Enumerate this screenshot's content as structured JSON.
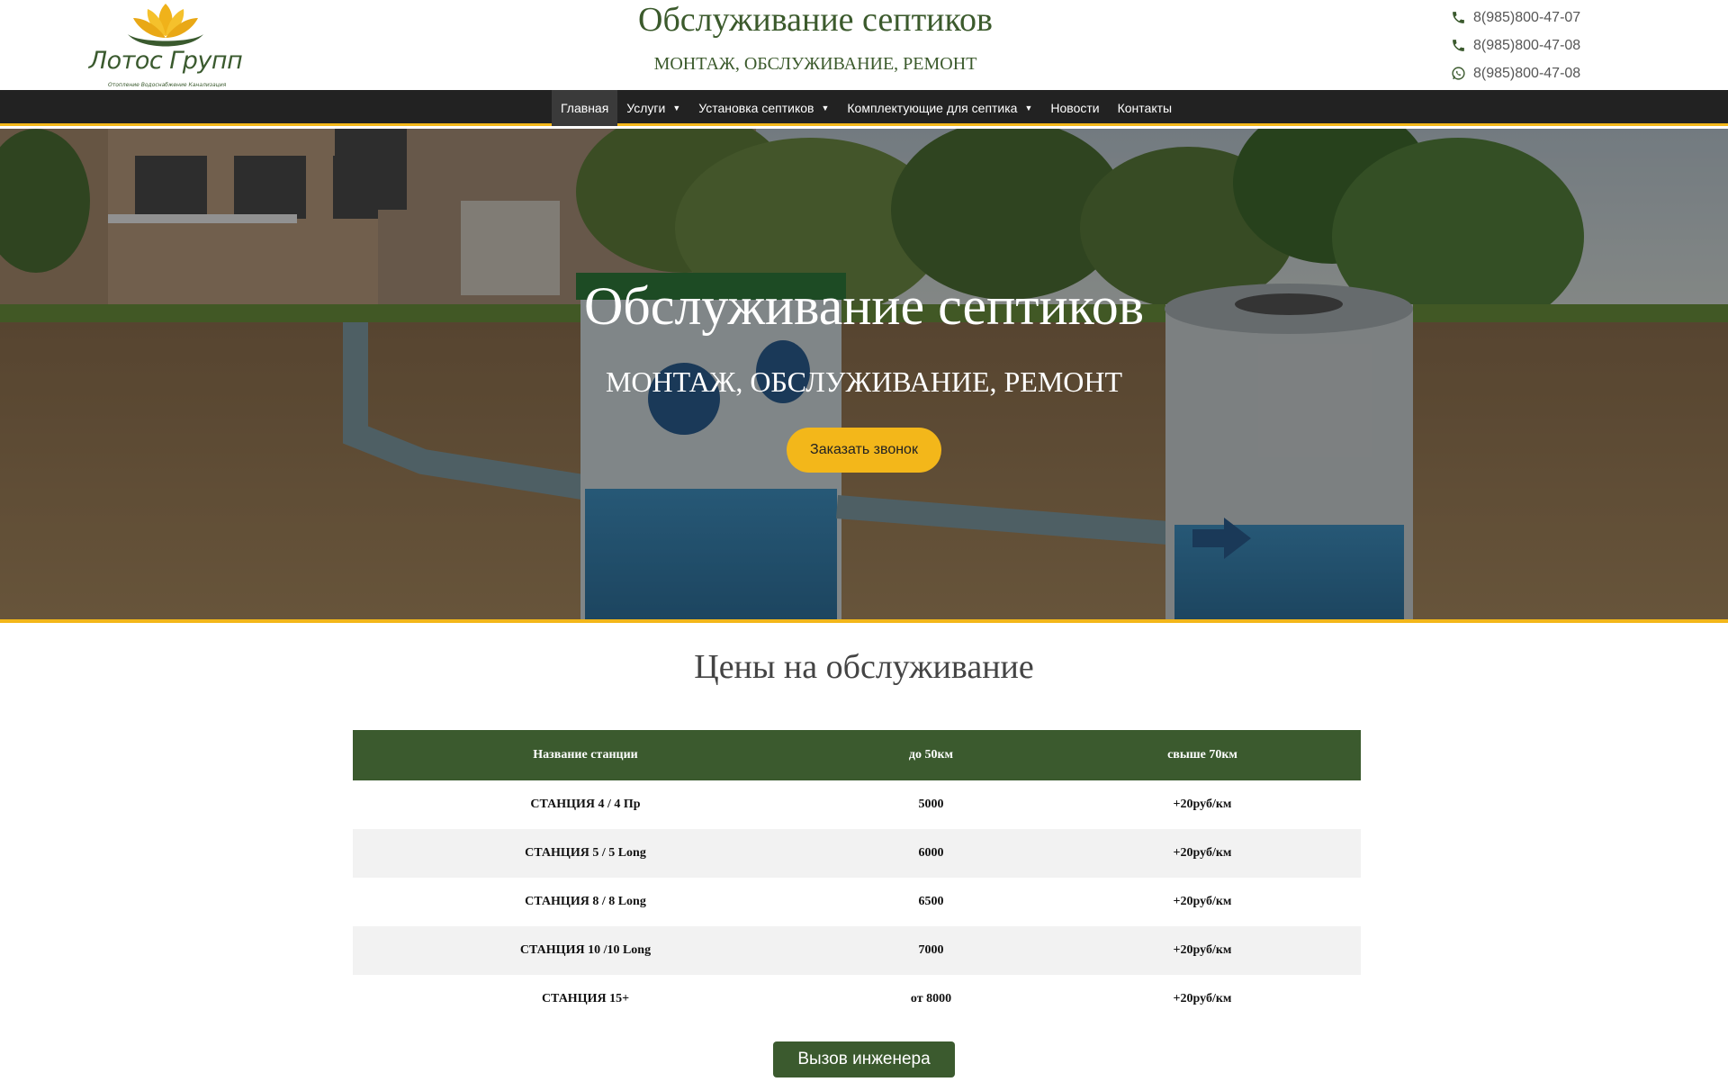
{
  "header": {
    "logo_text": "Лотос Групп",
    "logo_sub": "Отопление Водоснабжение Канализация",
    "title": "Обслуживание септиков",
    "subtitle": "МОНТАЖ, ОБСЛУЖИВАНИЕ, РЕМОНТ",
    "phones": [
      {
        "icon": "phone-icon",
        "number": "8(985)800-47-07"
      },
      {
        "icon": "phone-icon",
        "number": "8(985)800-47-08"
      },
      {
        "icon": "whatsapp-icon",
        "number": "8(985)800-47-08"
      }
    ]
  },
  "nav": {
    "items": [
      {
        "label": "Главная",
        "active": true,
        "dropdown": false
      },
      {
        "label": "Услуги",
        "dropdown": true
      },
      {
        "label": "Установка септиков",
        "dropdown": true
      },
      {
        "label": "Комплектующие для септика",
        "dropdown": true
      },
      {
        "label": "Новости",
        "dropdown": false
      },
      {
        "label": "Контакты",
        "dropdown": false
      }
    ],
    "caret": "▼"
  },
  "hero": {
    "title": "Обслуживание септиков",
    "subtitle": "МОНТАЖ, ОБСЛУЖИВАНИЕ, РЕМОНТ",
    "button_label": "Заказать звонок"
  },
  "prices": {
    "title": "Цены на обслуживание",
    "columns": [
      "Название станции",
      "до 50км",
      "свыше 70км"
    ],
    "rows": [
      [
        "СТАНЦИЯ 4 / 4 Пр",
        "5000",
        "+20руб/км"
      ],
      [
        "СТАНЦИЯ 5 / 5 Long",
        "6000",
        "+20руб/км"
      ],
      [
        "СТАНЦИЯ 8 / 8 Long",
        "6500",
        "+20руб/км"
      ],
      [
        "СТАНЦИЯ 10 /10 Long",
        "7000",
        "+20руб/км"
      ],
      [
        "СТАНЦИЯ 15+",
        "от 8000",
        "+20руб/км"
      ]
    ],
    "engineer_button": "Вызов инженера"
  },
  "colors": {
    "brand_green": "#3b5a2e",
    "accent_yellow": "#f3b71a",
    "nav_bg": "#222222"
  }
}
